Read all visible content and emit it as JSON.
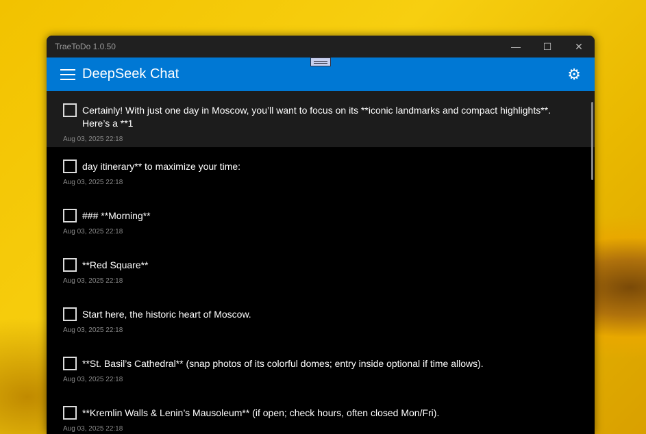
{
  "window": {
    "title": "TraeToDo 1.0.50"
  },
  "header": {
    "title": "DeepSeek Chat"
  },
  "items": [
    {
      "text": "Certainly! With just one day in Moscow, you’ll want to focus on its **iconic landmarks and compact highlights**. Here’s a **1",
      "date": "Aug 03, 2025 22:18"
    },
    {
      "text": "day itinerary** to maximize your time:",
      "date": "Aug 03, 2025 22:18"
    },
    {
      "text": "### **Morning**",
      "date": "Aug 03, 2025 22:18"
    },
    {
      "text": "**Red Square**",
      "date": "Aug 03, 2025 22:18"
    },
    {
      "text": "Start here, the historic heart of Moscow.",
      "date": "Aug 03, 2025 22:18"
    },
    {
      "text": "**St. Basil’s Cathedral** (snap photos of its colorful domes; entry inside optional if time allows).",
      "date": "Aug 03, 2025 22:18"
    },
    {
      "text": "**Kremlin Walls & Lenin’s Mausoleum** (if open; check hours, often closed Mon/Fri).",
      "date": "Aug 03, 2025 22:18"
    }
  ],
  "colors": {
    "accent": "#0078d4",
    "titlebar": "#202020",
    "selected_row": "#1c1c1c"
  }
}
